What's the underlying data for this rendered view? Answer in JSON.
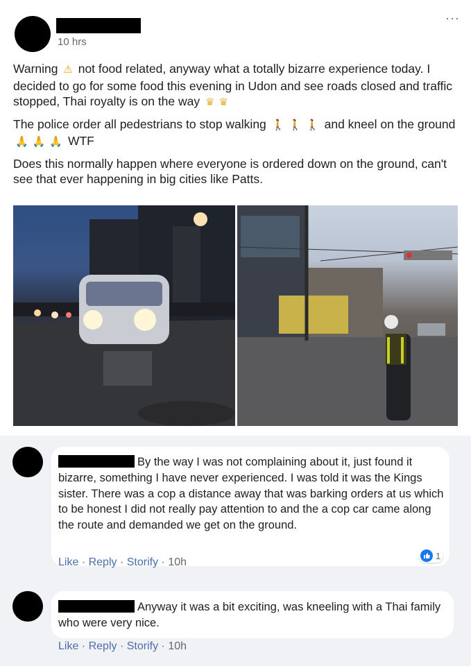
{
  "post": {
    "time": "10 hrs",
    "more": "···",
    "paragraphs": {
      "p1_a": "Warning",
      "p1_b": "not food related, anyway what a totally bizarre experience today. I decided to go for some food this evening in Udon and see roads closed and traffic stopped, Thai royalty is on the way",
      "p2_a": "The police order all pedestrians to stop walking",
      "p2_b": "and kneel on the ground",
      "p2_c": "WTF",
      "p3": "Does this normally happen where everyone is ordered down on the ground, can't see that ever happening in big cities like Patts."
    },
    "emoji": {
      "warning": "⚠",
      "crown": "♛",
      "walk": "🚶",
      "pray": "🙏"
    }
  },
  "comments": [
    {
      "text": "By the way I was not complaining about it, just found it bizarre, something I have never experienced. I was told it was the Kings sister. There was a cop a distance away that was barking orders at us which to be honest I did not really pay attention to and the a cop car came along the route and demanded we get on the ground.",
      "like": "Like",
      "reply": "Reply",
      "storify": "Storify",
      "time": "10h",
      "reactions": "1"
    },
    {
      "text": "Anyway it was a bit exciting, was kneeling with a Thai family who were very nice.",
      "like": "Like",
      "reply": "Reply",
      "storify": "Storify",
      "time": "10h"
    }
  ],
  "colors": {
    "link": "#4b6ea9",
    "meta": "#65676b",
    "comment_bg": "#f0f2f5",
    "like_blue": "#1877f2"
  }
}
